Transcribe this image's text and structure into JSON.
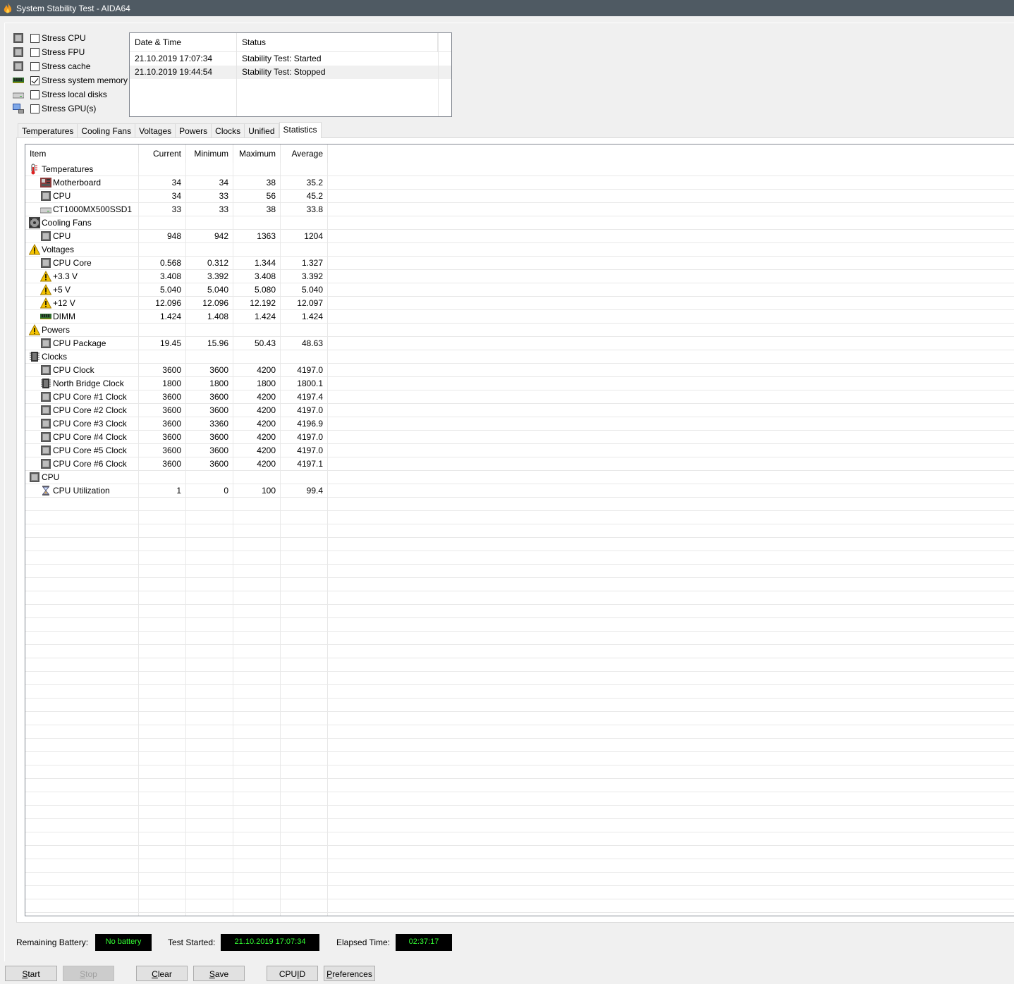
{
  "window": {
    "title": "System Stability Test - AIDA64"
  },
  "stress_options": [
    {
      "label": "Stress CPU",
      "checked": false,
      "icon": "cpu-chip-icon"
    },
    {
      "label": "Stress FPU",
      "checked": false,
      "icon": "fpu-chip-icon"
    },
    {
      "label": "Stress cache",
      "checked": false,
      "icon": "cache-chip-icon"
    },
    {
      "label": "Stress system memory",
      "checked": true,
      "icon": "memory-module-icon"
    },
    {
      "label": "Stress local disks",
      "checked": false,
      "icon": "disk-drive-icon"
    },
    {
      "label": "Stress GPU(s)",
      "checked": false,
      "icon": "monitor-icon"
    }
  ],
  "log": {
    "headers": [
      "Date & Time",
      "Status"
    ],
    "rows": [
      {
        "datetime": "21.10.2019 17:07:34",
        "status": "Stability Test: Started"
      },
      {
        "datetime": "21.10.2019 19:44:54",
        "status": "Stability Test: Stopped"
      }
    ]
  },
  "tabs": [
    "Temperatures",
    "Cooling Fans",
    "Voltages",
    "Powers",
    "Clocks",
    "Unified",
    "Statistics"
  ],
  "active_tab": "Statistics",
  "stats": {
    "headers": [
      "Item",
      "Current",
      "Minimum",
      "Maximum",
      "Average"
    ],
    "rows": [
      {
        "level": 0,
        "icon": "thermometer-icon",
        "item": "Temperatures",
        "current": "",
        "minimum": "",
        "maximum": "",
        "average": ""
      },
      {
        "level": 1,
        "icon": "motherboard-icon",
        "item": "Motherboard",
        "current": "34",
        "minimum": "34",
        "maximum": "38",
        "average": "35.2"
      },
      {
        "level": 1,
        "icon": "cpu-chip-icon",
        "item": "CPU",
        "current": "34",
        "minimum": "33",
        "maximum": "56",
        "average": "45.2"
      },
      {
        "level": 1,
        "icon": "disk-drive-icon",
        "item": "CT1000MX500SSD1",
        "current": "33",
        "minimum": "33",
        "maximum": "38",
        "average": "33.8"
      },
      {
        "level": 0,
        "icon": "fan-icon",
        "item": "Cooling Fans",
        "current": "",
        "minimum": "",
        "maximum": "",
        "average": ""
      },
      {
        "level": 1,
        "icon": "cpu-chip-icon",
        "item": "CPU",
        "current": "948",
        "minimum": "942",
        "maximum": "1363",
        "average": "1204"
      },
      {
        "level": 0,
        "icon": "warning-icon",
        "item": "Voltages",
        "current": "",
        "minimum": "",
        "maximum": "",
        "average": ""
      },
      {
        "level": 1,
        "icon": "cpu-chip-icon",
        "item": "CPU Core",
        "current": "0.568",
        "minimum": "0.312",
        "maximum": "1.344",
        "average": "1.327"
      },
      {
        "level": 1,
        "icon": "warning-icon",
        "item": "+3.3 V",
        "current": "3.408",
        "minimum": "3.392",
        "maximum": "3.408",
        "average": "3.392"
      },
      {
        "level": 1,
        "icon": "warning-icon",
        "item": "+5 V",
        "current": "5.040",
        "minimum": "5.040",
        "maximum": "5.080",
        "average": "5.040"
      },
      {
        "level": 1,
        "icon": "warning-icon",
        "item": "+12 V",
        "current": "12.096",
        "minimum": "12.096",
        "maximum": "12.192",
        "average": "12.097"
      },
      {
        "level": 1,
        "icon": "memory-module-icon",
        "item": "DIMM",
        "current": "1.424",
        "minimum": "1.408",
        "maximum": "1.424",
        "average": "1.424"
      },
      {
        "level": 0,
        "icon": "warning-icon",
        "item": "Powers",
        "current": "",
        "minimum": "",
        "maximum": "",
        "average": ""
      },
      {
        "level": 1,
        "icon": "cpu-chip-icon",
        "item": "CPU Package",
        "current": "19.45",
        "minimum": "15.96",
        "maximum": "50.43",
        "average": "48.63"
      },
      {
        "level": 0,
        "icon": "clock-chip-icon",
        "item": "Clocks",
        "current": "",
        "minimum": "",
        "maximum": "",
        "average": ""
      },
      {
        "level": 1,
        "icon": "cpu-chip-icon",
        "item": "CPU Clock",
        "current": "3600",
        "minimum": "3600",
        "maximum": "4200",
        "average": "4197.0"
      },
      {
        "level": 1,
        "icon": "clock-chip-icon",
        "item": "North Bridge Clock",
        "current": "1800",
        "minimum": "1800",
        "maximum": "1800",
        "average": "1800.1"
      },
      {
        "level": 1,
        "icon": "cpu-chip-icon",
        "item": "CPU Core #1 Clock",
        "current": "3600",
        "minimum": "3600",
        "maximum": "4200",
        "average": "4197.4"
      },
      {
        "level": 1,
        "icon": "cpu-chip-icon",
        "item": "CPU Core #2 Clock",
        "current": "3600",
        "minimum": "3600",
        "maximum": "4200",
        "average": "4197.0"
      },
      {
        "level": 1,
        "icon": "cpu-chip-icon",
        "item": "CPU Core #3 Clock",
        "current": "3600",
        "minimum": "3360",
        "maximum": "4200",
        "average": "4196.9"
      },
      {
        "level": 1,
        "icon": "cpu-chip-icon",
        "item": "CPU Core #4 Clock",
        "current": "3600",
        "minimum": "3600",
        "maximum": "4200",
        "average": "4197.0"
      },
      {
        "level": 1,
        "icon": "cpu-chip-icon",
        "item": "CPU Core #5 Clock",
        "current": "3600",
        "minimum": "3600",
        "maximum": "4200",
        "average": "4197.0"
      },
      {
        "level": 1,
        "icon": "cpu-chip-icon",
        "item": "CPU Core #6 Clock",
        "current": "3600",
        "minimum": "3600",
        "maximum": "4200",
        "average": "4197.1"
      },
      {
        "level": 0,
        "icon": "cpu-chip-icon",
        "item": "CPU",
        "current": "",
        "minimum": "",
        "maximum": "",
        "average": ""
      },
      {
        "level": 1,
        "icon": "hourglass-icon",
        "item": "CPU Utilization",
        "current": "1",
        "minimum": "0",
        "maximum": "100",
        "average": "99.4"
      }
    ]
  },
  "status_bar": {
    "battery_label": "Remaining Battery:",
    "battery_value": "No battery",
    "started_label": "Test Started:",
    "started_value": "21.10.2019 17:07:34",
    "elapsed_label": "Elapsed Time:",
    "elapsed_value": "02:37:17"
  },
  "buttons": {
    "start": "Start",
    "stop": "Stop",
    "clear": "Clear",
    "save": "Save",
    "cpuid": "CPUID",
    "preferences": "Preferences"
  },
  "colors": {
    "titlebar": "#4f5a63",
    "lcd_background": "#000000",
    "lcd_text": "#33ff33",
    "warning": "#f5c400"
  }
}
